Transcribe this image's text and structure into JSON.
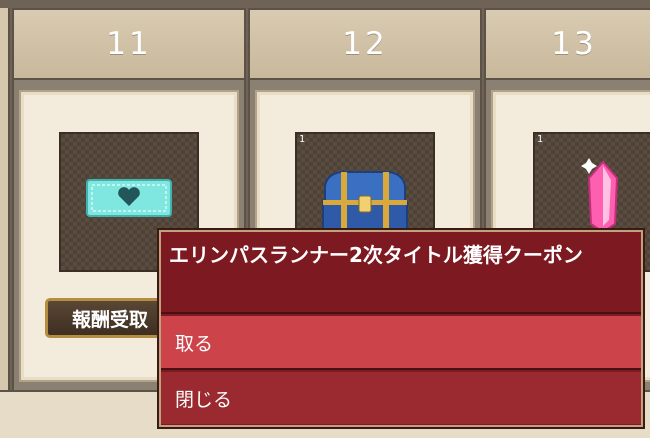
{
  "columns": [
    {
      "day": "11",
      "quantity": "",
      "item_icon": "heart-coupon-icon",
      "button_label": "報酬受取"
    },
    {
      "day": "12",
      "quantity": "1",
      "item_icon": "treasure-chest-icon"
    },
    {
      "day": "13",
      "quantity": "1",
      "item_icon": "pink-crystal-icon"
    }
  ],
  "popup": {
    "title": "エリンパスランナー2次タイトル獲得クーポン",
    "options": [
      "取る",
      "閉じる"
    ]
  },
  "colors": {
    "popup_bg": "#7d1a21",
    "popup_active": "#cc4449",
    "header_bg": "#d9cbb1",
    "cell_bg": "#f3ecdd"
  }
}
